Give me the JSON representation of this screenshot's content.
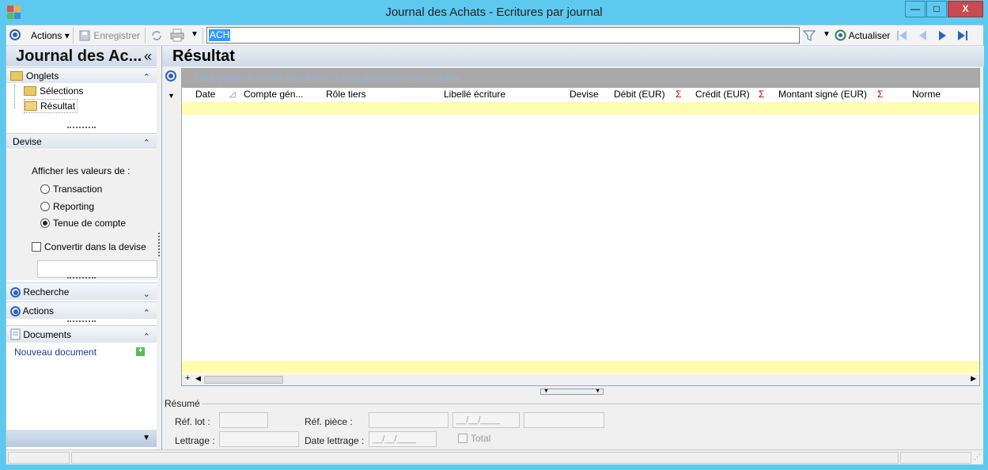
{
  "window": {
    "title": "Journal des Achats -  Ecritures par journal",
    "minimize_glyph": "—",
    "maximize_glyph": "□",
    "close_glyph": "X"
  },
  "toolbar": {
    "actions_label": "Actions",
    "save_label": "Enregistrer",
    "search_value": "ACH",
    "refresh_label": "Actualiser"
  },
  "left_panel": {
    "title": "Journal des Ac...",
    "collapse_glyph": "«",
    "tabs_section": {
      "title": "Onglets",
      "items": [
        "Sélections",
        "Résultat"
      ]
    },
    "currency_section": {
      "title": "Devise",
      "prompt": "Afficher les valeurs de :",
      "options": [
        "Transaction",
        "Reporting",
        "Tenue de compte"
      ],
      "selected": "Tenue de compte",
      "convert_label": "Convertir dans la devise"
    },
    "search_section": {
      "title": "Recherche"
    },
    "actions_section": {
      "title": "Actions"
    },
    "documents_section": {
      "title": "Documents",
      "new_doc_label": "Nouveau document"
    }
  },
  "main": {
    "title": "Résultat",
    "group_hint": "Faire glisser un en-tête de colonne ici pour grouper par cette colonne",
    "columns": [
      "Date",
      "Compte gén...",
      "Rôle tiers",
      "Libellé écriture",
      "Devise",
      "Débit (EUR)",
      "Crédit (EUR)",
      "Montant signé (EUR)",
      "Norme"
    ],
    "sigma_glyph": "Σ"
  },
  "summary": {
    "title": "Résumé",
    "ref_lot_label": "Réf. lot :",
    "ref_piece_label": "Réf. pièce :",
    "lettrage_label": "Lettrage :",
    "date_lettrage_label": "Date lettrage :",
    "date_placeholder": "__/__/____",
    "total_label": "Total"
  },
  "colors": {
    "titlebar": "#5ec9ef",
    "selection": "#3399ff",
    "grid_yellow": "#fffdb0",
    "accent_blue": "#2c63b5"
  }
}
